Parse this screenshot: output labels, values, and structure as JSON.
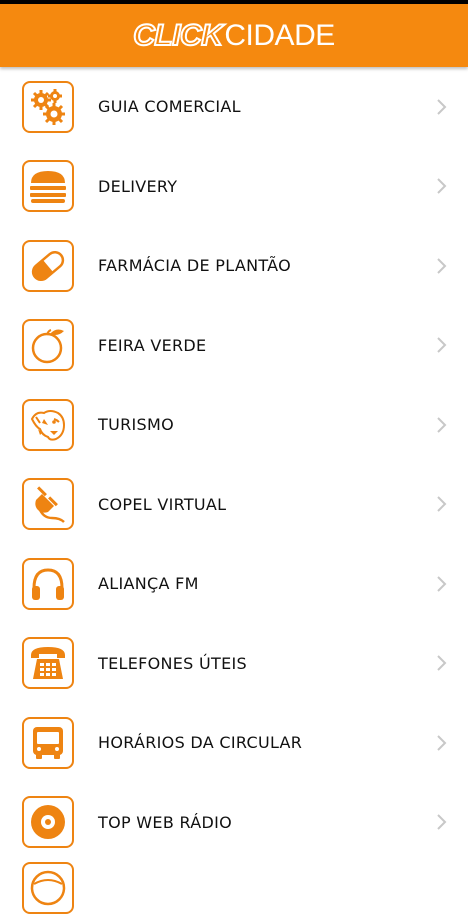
{
  "app": {
    "logo_click": "CLICK",
    "logo_cidade": "CIDADE",
    "accent": "#f5890f"
  },
  "menu": [
    {
      "label": "GUIA COMERCIAL",
      "icon": "gears-icon"
    },
    {
      "label": "DELIVERY",
      "icon": "burger-icon"
    },
    {
      "label": "FARMÁCIA DE PLANTÃO",
      "icon": "pill-icon"
    },
    {
      "label": "FEIRA VERDE",
      "icon": "orange-fruit-icon"
    },
    {
      "label": "TURISMO",
      "icon": "jaguar-icon"
    },
    {
      "label": "COPEL VIRTUAL",
      "icon": "plug-icon"
    },
    {
      "label": "ALIANÇA FM",
      "icon": "headphones-icon"
    },
    {
      "label": "TELEFONES ÚTEIS",
      "icon": "telephone-icon"
    },
    {
      "label": "HORÁRIOS DA CIRCULAR",
      "icon": "bus-icon"
    },
    {
      "label": "TOP WEB RÁDIO",
      "icon": "disc-icon"
    },
    {
      "label": "",
      "icon": "globe-icon"
    }
  ]
}
